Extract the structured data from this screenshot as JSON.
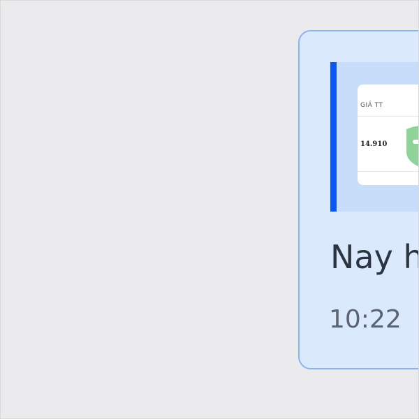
{
  "message": {
    "quoted_preview": {
      "header_text": "GIẢ TT",
      "amount_text": "14.910"
    },
    "text": "Nay h",
    "time": "10:22"
  },
  "icons": {
    "preview": "receipt-icon"
  },
  "colors": {
    "background": "#ebebed",
    "bubble": "#dbe9fd",
    "bubble_border": "#8ab4f0",
    "quote_bar": "#0b57f5",
    "quote_background": "#c8ddf9",
    "icon_green": "#8fd39a"
  }
}
